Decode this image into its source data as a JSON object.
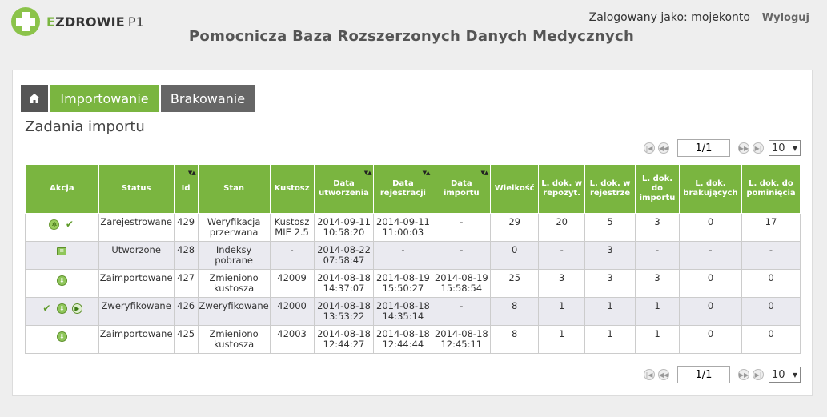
{
  "header": {
    "logo_accent": "E",
    "logo_main": "ZDROWIE",
    "logo_suffix": "P1",
    "user_label": "Zalogowany jako: mojekonto",
    "logout_label": "Wyloguj",
    "app_title": "Pomocnicza Baza Rozszerzonych Danych Medycznych"
  },
  "tabs": [
    {
      "label": "",
      "icon": "home-icon"
    },
    {
      "label": "Importowanie"
    },
    {
      "label": "Brakowanie"
    }
  ],
  "section_title": "Zadania importu",
  "pager": {
    "page": "1/1",
    "page_size": "10",
    "icons": [
      "first-page-icon",
      "prev-page-icon",
      "next-page-icon",
      "last-page-icon"
    ]
  },
  "columns": [
    {
      "label": "Akcja",
      "sort": ""
    },
    {
      "label": "Status",
      "sort": ""
    },
    {
      "label": "Id",
      "sort": "▼▲"
    },
    {
      "label": "Stan",
      "sort": ""
    },
    {
      "label": "Kustosz",
      "sort": ""
    },
    {
      "label": "Data utworzenia",
      "sort": "▼▲"
    },
    {
      "label": "Data rejestracji",
      "sort": "▼▲"
    },
    {
      "label": "Data importu",
      "sort": "▼▲"
    },
    {
      "label": "Wielkość",
      "sort": ""
    },
    {
      "label": "L. dok. w repozyt.",
      "sort": ""
    },
    {
      "label": "L. dok. w rejestrze",
      "sort": ""
    },
    {
      "label": "L. dok. do importu",
      "sort": ""
    },
    {
      "label": "L. dok. brakujących",
      "sort": ""
    },
    {
      "label": "L. dok. do pominięcia",
      "sort": ""
    }
  ],
  "rows": [
    {
      "actions": [
        "gear-icon",
        "check-icon"
      ],
      "cells": [
        "Zarejestrowane",
        "429",
        "Weryfikacja przerwana",
        "Kustosz MIE 2.5",
        "2014-09-11 10:58:20",
        "2014-09-11 11:00:03",
        "-",
        "29",
        "20",
        "5",
        "3",
        "0",
        "17"
      ]
    },
    {
      "actions": [
        "document-icon"
      ],
      "cells": [
        "Utworzone",
        "428",
        "Indeksy pobrane",
        "-",
        "2014-08-22 07:58:47",
        "-",
        "-",
        "0",
        "-",
        "3",
        "-",
        "-",
        "-"
      ]
    },
    {
      "actions": [
        "download-icon"
      ],
      "cells": [
        "Zaimportowane",
        "427",
        "Zmieniono kustosza",
        "42009",
        "2014-08-18 14:37:07",
        "2014-08-19 15:50:27",
        "2014-08-19 15:58:54",
        "25",
        "3",
        "3",
        "3",
        "0",
        "0"
      ]
    },
    {
      "actions": [
        "check-icon",
        "download-icon",
        "play-icon"
      ],
      "cells": [
        "Zweryfikowane",
        "426",
        "Zweryfikowane",
        "42000",
        "2014-08-18 13:53:22",
        "2014-08-18 14:35:14",
        "-",
        "8",
        "1",
        "1",
        "1",
        "0",
        "0"
      ]
    },
    {
      "actions": [
        "download-icon"
      ],
      "cells": [
        "Zaimportowane",
        "425",
        "Zmieniono kustosza",
        "42003",
        "2014-08-18 12:44:27",
        "2014-08-18 12:44:44",
        "2014-08-18 12:45:11",
        "8",
        "1",
        "1",
        "1",
        "0",
        "0"
      ]
    }
  ]
}
